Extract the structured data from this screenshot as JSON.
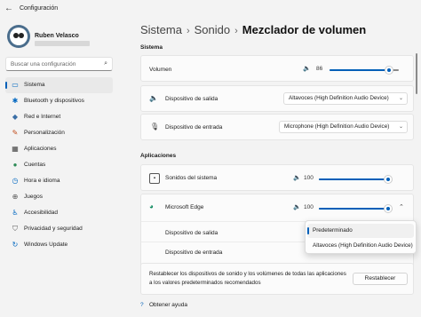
{
  "window": {
    "title": "Configuración",
    "back_icon": "arrow-left-icon"
  },
  "user": {
    "name": "Ruben Velasco"
  },
  "search": {
    "placeholder": "Buscar una configuración"
  },
  "nav": {
    "items": [
      {
        "label": "Sistema",
        "icon": "monitor-icon",
        "glyph": "▭",
        "color": "#0067c0",
        "active": true
      },
      {
        "label": "Bluetooth y dispositivos",
        "icon": "bluetooth-icon",
        "glyph": "✱",
        "color": "#0067c0"
      },
      {
        "label": "Red e Internet",
        "icon": "wifi-icon",
        "glyph": "◆",
        "color": "#3a6ea5"
      },
      {
        "label": "Personalización",
        "icon": "brush-icon",
        "glyph": "✎",
        "color": "#c24d1c"
      },
      {
        "label": "Aplicaciones",
        "icon": "apps-icon",
        "glyph": "▦",
        "color": "#444444"
      },
      {
        "label": "Cuentas",
        "icon": "person-icon",
        "glyph": "●",
        "color": "#2e8b57"
      },
      {
        "label": "Hora e idioma",
        "icon": "clock-globe-icon",
        "glyph": "◷",
        "color": "#0067c0"
      },
      {
        "label": "Juegos",
        "icon": "gamepad-icon",
        "glyph": "⊕",
        "color": "#555555"
      },
      {
        "label": "Accesibilidad",
        "icon": "accessibility-icon",
        "glyph": "♿",
        "color": "#0067c0"
      },
      {
        "label": "Privacidad y seguridad",
        "icon": "shield-icon",
        "glyph": "⛉",
        "color": "#555555"
      },
      {
        "label": "Windows Update",
        "icon": "update-icon",
        "glyph": "↻",
        "color": "#0067c0"
      }
    ]
  },
  "breadcrumb": {
    "item1": "Sistema",
    "sep": "›",
    "item2": "Sonido",
    "current": "Mezclador de volumen"
  },
  "sistema": {
    "section_label": "Sistema",
    "volume": {
      "label": "Volumen",
      "value": "86",
      "level": 0.86
    },
    "output": {
      "label": "Dispositivo de salida",
      "value": "Altavoces (High Definition Audio Device)"
    },
    "input": {
      "label": "Dispositivo de entrada",
      "value": "Microphone (High Definition Audio Device)"
    }
  },
  "apps": {
    "section_label": "Aplicaciones",
    "system_sounds": {
      "label": "Sonidos del sistema",
      "value": "100",
      "level": 1.0
    },
    "edge": {
      "label": "Microsoft Edge",
      "value": "100",
      "level": 1.0,
      "output_label": "Dispositivo de salida",
      "input_label": "Dispositivo de entrada"
    }
  },
  "dropdown": {
    "options": [
      "Predeterminado",
      "Altavoces (High Definition Audio Device)"
    ],
    "selected_index": 0
  },
  "reset": {
    "text_line1": "Restablecer los dispositivos de sonido y los volúmenes de todas las aplicaciones",
    "text_line2": "a los valores predeterminados recomendados",
    "button_label": "Restablecer"
  },
  "help": {
    "label": "Obtener ayuda"
  },
  "colors": {
    "accent": "#005fb8"
  }
}
